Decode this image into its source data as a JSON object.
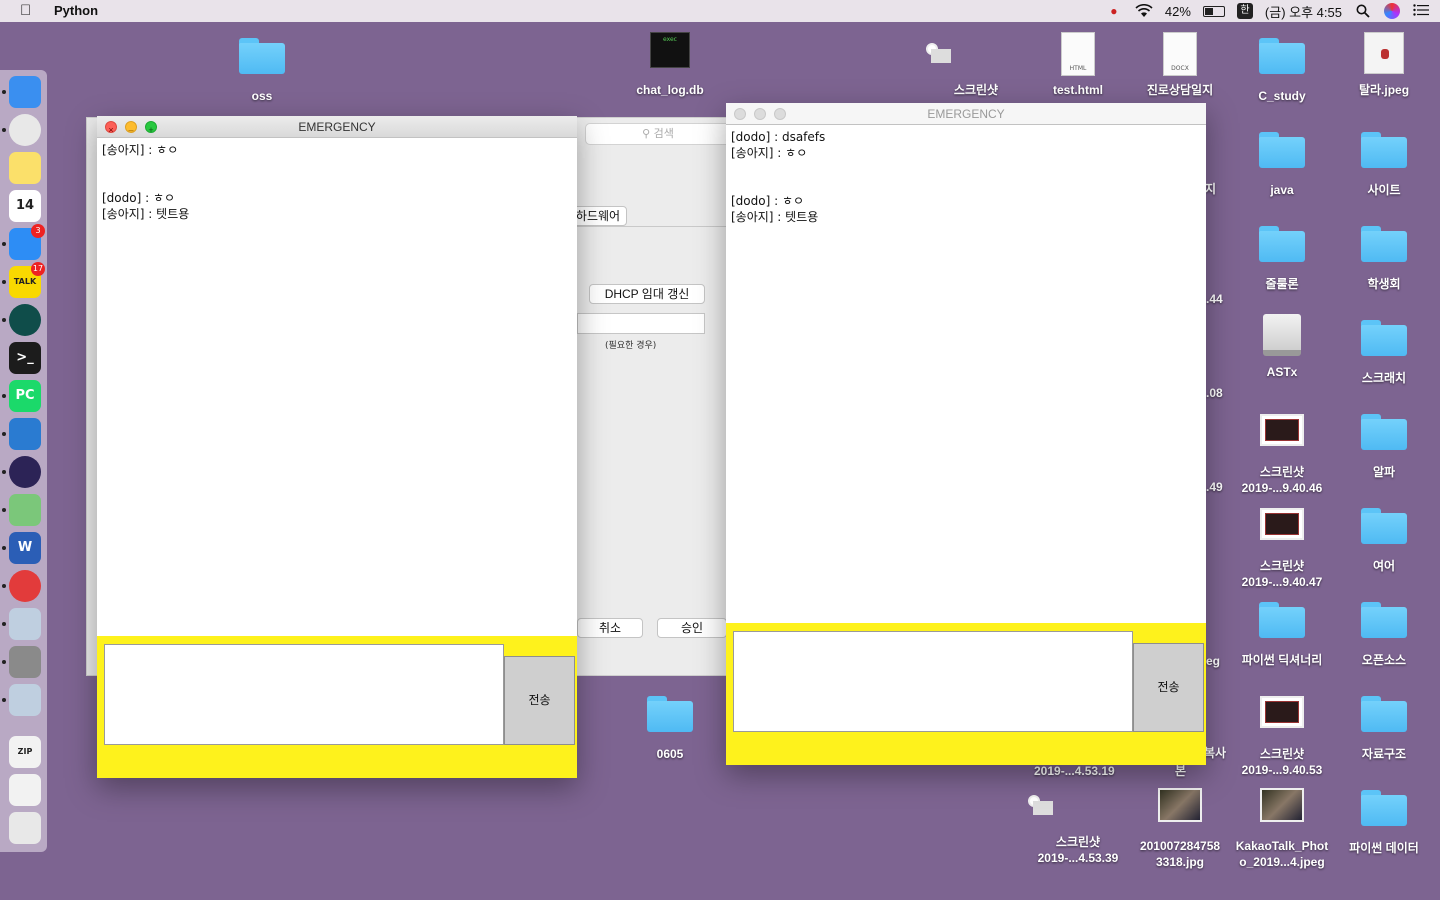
{
  "menubar": {
    "app_name": "Python",
    "battery_percent": "42%",
    "input_method": "한",
    "datetime": "(금) 오후 4:55"
  },
  "dock": {
    "items": [
      {
        "name": "finder",
        "color": "#3a8ff0"
      },
      {
        "name": "chrome",
        "color": "#e8e8e8"
      },
      {
        "name": "notes",
        "color": "#fbe06a"
      },
      {
        "name": "calendar",
        "label": "14",
        "color": "#ffffff"
      },
      {
        "name": "app-store",
        "badge": "3",
        "color": "#2d8df5"
      },
      {
        "name": "kakaotalk",
        "label": "TALK",
        "badge": "17",
        "color": "#f9d900"
      },
      {
        "name": "gitkraken",
        "color": "#0f4d4a"
      },
      {
        "name": "terminal",
        "label": ">_",
        "color": "#1c1c1c"
      },
      {
        "name": "pycharm",
        "label": "PC",
        "color": "#1bd96a"
      },
      {
        "name": "vscode",
        "color": "#2a7bd1"
      },
      {
        "name": "eclipse",
        "color": "#2c2356"
      },
      {
        "name": "android-studio",
        "color": "#7bc77a"
      },
      {
        "name": "word",
        "label": "W",
        "color": "#2b5eb6"
      },
      {
        "name": "airmail",
        "color": "#e23b3b"
      },
      {
        "name": "rocket",
        "color": "#bfcfe0"
      },
      {
        "name": "system-preferences",
        "color": "#8a8a8a"
      },
      {
        "name": "rocket-2",
        "color": "#bfcfe0"
      },
      {
        "name": "zip-file",
        "label": "ZIP",
        "color": "#f2f2f2"
      },
      {
        "name": "screenshot-stack",
        "color": "#f2f2f2"
      },
      {
        "name": "trash",
        "color": "#e8e8e8"
      }
    ]
  },
  "desktop": {
    "icons": [
      {
        "label": "oss",
        "kind": "folder"
      },
      {
        "label": "chat_log.db",
        "kind": "exec",
        "tag": "exec"
      },
      {
        "label": "스크린샷",
        "kind": "thumb-light"
      },
      {
        "label": "test.html",
        "kind": "doc",
        "tag": "HTML"
      },
      {
        "label": "진로상담일지",
        "kind": "doc",
        "tag": "DOCX"
      },
      {
        "label": "C_study",
        "kind": "folder"
      },
      {
        "label": "탈라.jpeg",
        "kind": "girl"
      },
      {
        "label": "java",
        "kind": "folder"
      },
      {
        "label": "사이트",
        "kind": "folder"
      },
      {
        "label": "줄룰론",
        "kind": "folder"
      },
      {
        "label": "학생회",
        "kind": "folder"
      },
      {
        "label": "ASTx",
        "kind": "drive"
      },
      {
        "label": "스크래치",
        "kind": "folder"
      },
      {
        "label": "스크린샷\n2019-...9.40.46",
        "kind": "thumb-dark"
      },
      {
        "label": "알파",
        "kind": "folder"
      },
      {
        "label": "스크린샷\n2019-...9.40.47",
        "kind": "thumb-dark"
      },
      {
        "label": "여어",
        "kind": "folder"
      },
      {
        "label": "파이썬 딕셔너리",
        "kind": "folder"
      },
      {
        "label": "오픈소스",
        "kind": "folder"
      },
      {
        "label": "스크린샷\n2019-...9.40.53",
        "kind": "thumb-dark"
      },
      {
        "label": "자료구조",
        "kind": "folder"
      },
      {
        "label": "0605",
        "kind": "folder"
      },
      {
        "label": "스크린샷\n2019-...4.53.39",
        "kind": "thumb-light"
      },
      {
        "label": "201007284758\n3318.jpg",
        "kind": "photo"
      },
      {
        "label": "KakaoTalk_Phot\no_2019...4.jpeg",
        "kind": "photo"
      },
      {
        "label": "파이썬 데이터",
        "kind": "folder"
      }
    ],
    "partial_labels": [
      "지",
      ".44",
      ".08",
      ".49",
      "eg",
      "복사",
      "2019-...4.53.19",
      "본"
    ]
  },
  "network_window": {
    "search_placeholder": "검색",
    "hardware_tab": "하드웨어",
    "dhcp_button": "DHCP 임대 갱신",
    "hint": "(필요한 경우)",
    "cancel_button": "취소",
    "approve_button": "승인"
  },
  "chat_left": {
    "title": "EMERGENCY",
    "messages": [
      "[송아지] : ㅎㅇ",
      "",
      "",
      "[dodo] : ㅎㅇ",
      "[송아지] : 텟트용"
    ],
    "send_label": "전송",
    "input_value": ""
  },
  "chat_right": {
    "title": "EMERGENCY",
    "messages": [
      "[dodo] : dsafefs",
      "[송아지] : ㅎㅇ",
      "",
      "",
      "[dodo] : ㅎㅇ",
      "[송아지] : 텟트용"
    ],
    "send_label": "전송",
    "input_value": ""
  },
  "colors": {
    "desktop": "#7d6491",
    "chat_yellow": "#fef21c",
    "folder_blue": "#5cc4f7"
  }
}
